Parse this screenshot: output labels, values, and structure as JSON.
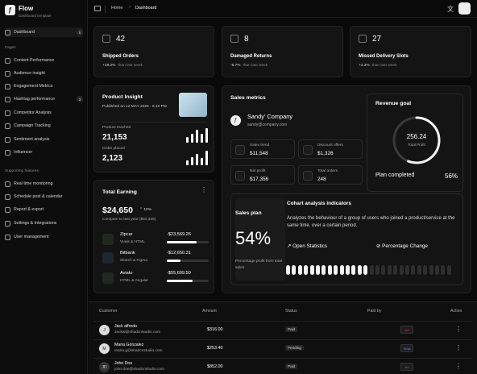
{
  "app": {
    "brand": "Flow",
    "brand_sub": "Dashboard template"
  },
  "sidebar": {
    "top_item": {
      "label": "Dashboard",
      "badge": "5"
    },
    "section_pages": "Pages",
    "pages": [
      {
        "label": "Content Performance"
      },
      {
        "label": "Audience insight"
      },
      {
        "label": "Engagement Metrics"
      },
      {
        "label": "Hashtag performance",
        "badge": "3"
      },
      {
        "label": "Competitor Analysis"
      },
      {
        "label": "Campaign Tracking"
      },
      {
        "label": "Sentiment analysis"
      },
      {
        "label": "Influencer"
      }
    ],
    "section_features": "Supporting features",
    "features": [
      {
        "label": "Real time monitoring"
      },
      {
        "label": "Schedule post & calendar"
      },
      {
        "label": "Report & export"
      },
      {
        "label": "Settings & Integrations"
      },
      {
        "label": "User management"
      }
    ]
  },
  "topbar": {
    "breadcrumb_home": "Home",
    "breadcrumb_current": "Dashboard"
  },
  "stats": [
    {
      "value": "42",
      "title": "Shipped Orders",
      "delta": "+18.2%",
      "note": "than last week",
      "icon": "box-icon"
    },
    {
      "value": "8",
      "title": "Damaged Returns",
      "delta": "-8.7%",
      "note": "than last week",
      "icon": "warning-icon"
    },
    {
      "value": "27",
      "title": "Missed Delivery Slots",
      "delta": "+4.3%",
      "note": "than last week",
      "icon": "calendar-icon"
    }
  ],
  "product_insight": {
    "title": "Product Insight",
    "published": "Published on 12 MAY 2025 - 6:10 PM",
    "reached_label": "Product reached",
    "reached_value": "21,153",
    "placed_label": "Order placed",
    "placed_value": "2,123",
    "bars1": [
      0.4,
      0.6,
      0.9,
      0.6,
      1.0
    ],
    "bars2": [
      0.35,
      0.55,
      0.8,
      0.5,
      1.0
    ]
  },
  "total_earning": {
    "title": "Total Earning",
    "amount": "$24,650",
    "change": "10%",
    "compare": "Compare to last year ($84,325)",
    "rows": [
      {
        "name": "Zipcar",
        "sub": "Vuejs & HTML",
        "amount": "-$23,569.26",
        "progress": 0.72
      },
      {
        "name": "Bitbank",
        "sub": "Sketch & Figma",
        "amount": "-$12,650.31",
        "progress": 0.32
      },
      {
        "name": "Aviato",
        "sub": "HTML & Angular",
        "amount": "-$55,699.50",
        "progress": 0.62
      }
    ]
  },
  "sales_metrics": {
    "title": "Sales metrics",
    "company": "Sandy' Company",
    "email": "sandy@company.com",
    "items": [
      {
        "label": "Sales trend",
        "value": "$11,548",
        "icon": "trend-icon"
      },
      {
        "label": "Discount offers",
        "value": "$1,326",
        "icon": "discount-icon"
      },
      {
        "label": "Net profit",
        "value": "$17,356",
        "icon": "dollar-icon"
      },
      {
        "label": "Total orders",
        "value": "248",
        "icon": "calendar-icon"
      }
    ]
  },
  "revenue_goal": {
    "title": "Revenue goal",
    "value": "256.24",
    "sub": "Total Profit",
    "completed_label": "Plan completed",
    "percent": "56%",
    "fraction": 0.56
  },
  "sales_plan": {
    "title": "Sales plan",
    "percent": "54%",
    "caption": "Percentage profit from total sales"
  },
  "cohort": {
    "title": "Cohart analysis indicators",
    "desc": "Analyzes the behaviour of a group of users who joined a product/service at the same time. over a certain period.",
    "open_label": "Open Statistics",
    "pct_label": "Percentage Change",
    "filled_fraction": 0.5
  },
  "table": {
    "headers": {
      "customer": "Customer",
      "amount": "Amount",
      "status": "Status",
      "paid_by": "Paid by",
      "action": "Action"
    },
    "rows": [
      {
        "name": "Jack alfredo",
        "email": "Jackal@shadcnstudio.com",
        "amount": "$316.00",
        "status": "Paid",
        "pay": "mastercard",
        "avatar": "J"
      },
      {
        "name": "Maria Gonzalez",
        "email": "maria.g@shadcnstudio.com",
        "amount": "$253.40",
        "status": "Pending",
        "pay": "VISA",
        "avatar": "M"
      },
      {
        "name": "John Doe",
        "email": "john.doe@shadcnstudio.com",
        "amount": "$852.00",
        "status": "Paid",
        "pay": "mastercard",
        "avatar": "JD"
      }
    ]
  }
}
